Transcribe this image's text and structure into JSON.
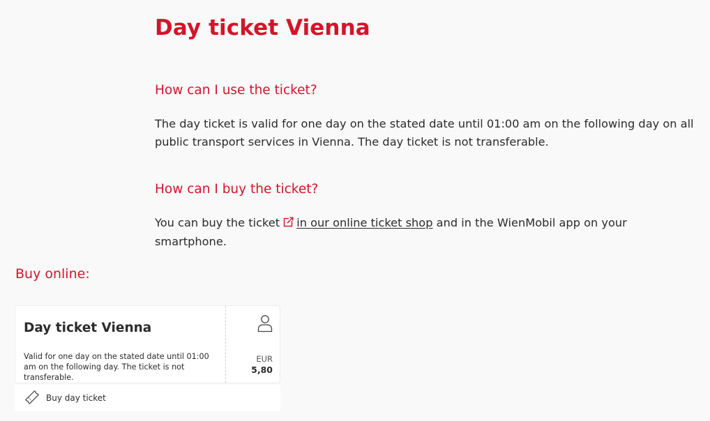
{
  "page": {
    "title": "Day ticket Vienna"
  },
  "sections": [
    {
      "heading": "How can I use the ticket?",
      "text": "The day ticket is valid for one day on the stated date until 01:00 am on the following day on all public transport services in Vienna. The day ticket is not transferable."
    },
    {
      "heading": "How can I buy the ticket?",
      "text_before": "You can buy the ticket ",
      "link_text": "in our online ticket shop",
      "text_after": " and in the WienMobil app on your smartphone.",
      "link_icon": "external-link-icon"
    }
  ],
  "buy_online": {
    "heading": "Buy online:",
    "card": {
      "title": "Day ticket Vienna",
      "description": "Valid for one day on the stated date until 01:00 am on the following day. The ticket is not transferable.",
      "passenger_icon": "person-icon",
      "currency": "EUR",
      "price": "5,80",
      "buy_label": "Buy day ticket",
      "buy_icon": "ticket-icon"
    }
  },
  "colors": {
    "accent": "#d4142a",
    "text": "#2b2b2b",
    "background": "#f9f9f9",
    "card": "#ffffff"
  }
}
